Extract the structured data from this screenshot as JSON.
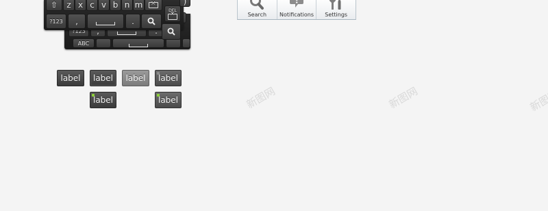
{
  "keyboard": {
    "row3": [
      "z",
      "x",
      "c",
      "v",
      "b",
      "n",
      "m"
    ],
    "shift_label": "⇧",
    "del_label": "DEL",
    "sym_label": "?123",
    "comma_label": ",",
    "period_label": ".",
    "paren_label": ")",
    "abc_label": "ABC"
  },
  "action_bar": {
    "items": [
      {
        "label": "Search",
        "icon": "search-icon"
      },
      {
        "label": "Notifications",
        "icon": "notifications-icon"
      },
      {
        "label": "Settings",
        "icon": "settings-icon"
      }
    ]
  },
  "buttons": {
    "label_text": "label",
    "indicator_colors": {
      "green": "#8ed13a",
      "gray": "#8a8a8a"
    }
  },
  "watermark": "新图网"
}
